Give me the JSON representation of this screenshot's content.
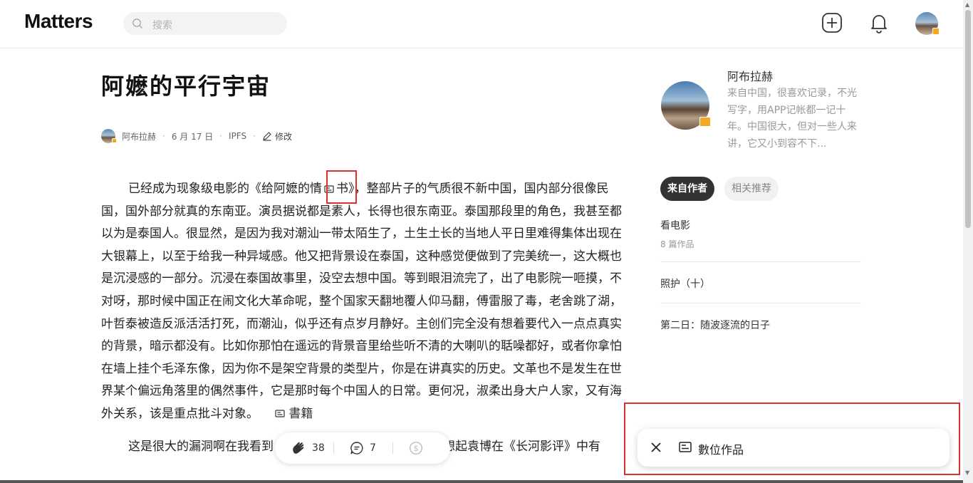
{
  "header": {
    "logo": "Matters",
    "search_placeholder": "搜索",
    "icons": [
      "search-icon",
      "add-icon",
      "bell-icon",
      "avatar"
    ]
  },
  "article": {
    "title": "阿嬷的平行宇宙",
    "author": "阿布拉赫",
    "date": "6 月 17 日",
    "storage": "IPFS",
    "edit_label": "修改",
    "body_before": "已经成为现象级电影的《给阿嬷的情",
    "body_after": "书》，整部片子的气质很不新中国，国内部分很像民国，国外部分就真的东南亚。演员据说都是素人，长得也很东南亚。泰国那段里的角色，我甚至都以为是泰国人。很显然，是因为我对潮汕一带太陌生了，土生土长的当地人平日里难得集体出现在大银幕上，以至于给我一种异域感。他又把背景设在泰国，这种感觉便做到了完美统一，这大概也是沉浸感的一部分。沉浸在泰国故事里，没空去想中国。等到眼泪流完了，出了电影院一咂摸，不对呀，那时候中国正在闹文化大革命呢，整个国家天翻地覆人仰马翻，傅雷服了毒，老舍跳了湖，叶哲泰被造反派活活打死，而潮汕，似乎还有点岁月静好。主创们完全没有想着要代入一点点真实的背景，暗示都没有。比如你那怕在遥远的背景音里给些听不清的大喇叭的聒噪都好，或者你拿怕在墙上挂个毛泽东像，因为你不是架空背景的类型片，你是在讲真实的历史。文革也不是发生在世界某个偏远角落里的偶然事件，它是那时每个中国人的日常。更何况，淑柔出身大户人家，又有海外关系，该是重点批斗对象。",
    "book_tag": "書籍",
    "next_line": "这是很大的漏洞啊在我看到，可惜大部分中国人不在乎，我想起袁博在《长河影评》中有"
  },
  "actions": {
    "claps": "38",
    "comments": "7"
  },
  "sidebar": {
    "author_name": "阿布拉赫",
    "author_bio": "来自中国，很喜欢记录，不光写字，用APP记帐都一记十年。中国很大，但对一些人来讲，它又小到容不下...",
    "tab_from_author": "来自作者",
    "tab_related": "相关推荐",
    "items": [
      {
        "title": "看电影",
        "sub": "8 篇作品"
      },
      {
        "title": "照护（十）",
        "sub": ""
      },
      {
        "title": "第二日：随波逐流的日子",
        "sub": ""
      }
    ]
  },
  "toast": {
    "label": "數位作品"
  },
  "colors": {
    "highlight_box": "#e0302d",
    "tab_active_bg": "#333333",
    "badge": "#f5a623"
  }
}
